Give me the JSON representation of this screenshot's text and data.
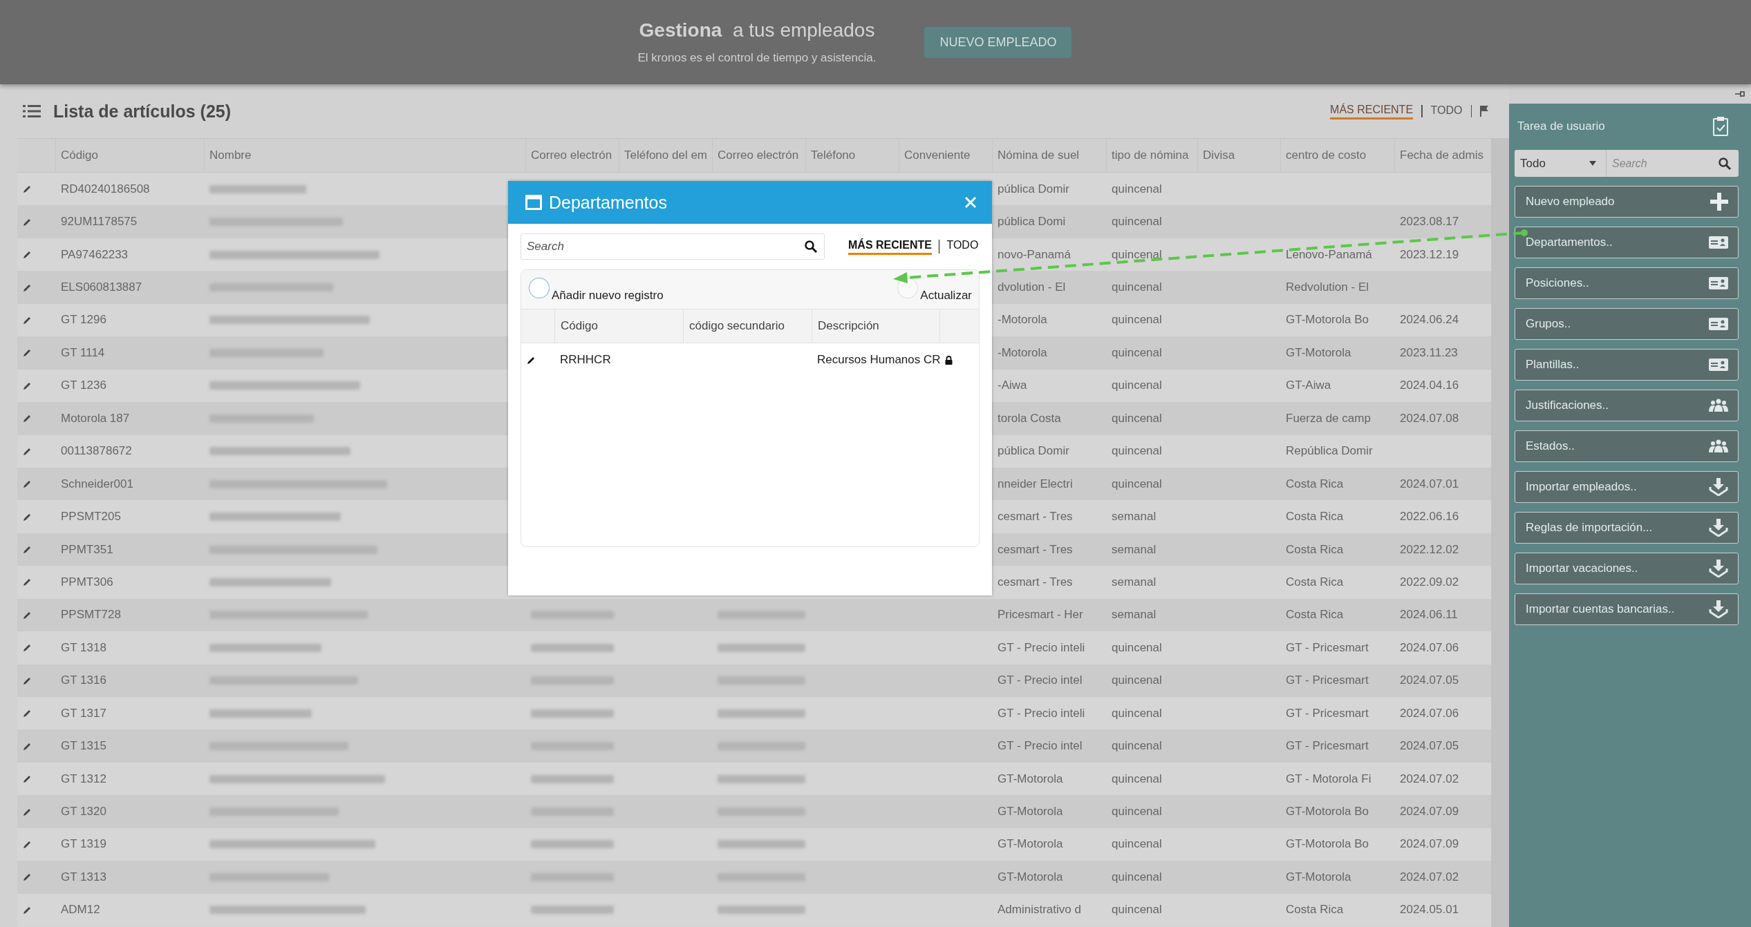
{
  "header": {
    "headline": "**Gestiona**  a tus empleados",
    "subtitle": "El kronos es el control de tiempo y asistencia.",
    "button": "NUEVO EMPLEADO"
  },
  "list": {
    "title": "Lista de artículos (25)",
    "filters": [
      {
        "label": "MÁS RECIENTE",
        "selected": true
      },
      {
        "label": "TODO",
        "selected": false
      }
    ]
  },
  "table": {
    "columns": [
      "Código",
      "Nombre",
      "Correo electrón",
      "Teléfono del em",
      "Correo electrón",
      "Teléfono",
      "Conveniente",
      "Nómina de suel",
      "tipo de nómina",
      "Divisa",
      "centro de costo",
      "Fecha de admis"
    ],
    "rows": [
      {
        "code": "RD40240186508",
        "payroll": "pública Domir",
        "payroll_type": "quincenal"
      },
      {
        "code": "92UM1178575",
        "payroll": "pública Domi",
        "payroll_type": "quincenal",
        "hire_date": "2023.08.17"
      },
      {
        "code": "PA97462233",
        "payroll": "novo-Panamá",
        "payroll_type": "quincenal",
        "cost_center": "Lenovo-Panamá",
        "hire_date": "2023.12.19"
      },
      {
        "code": "ELS060813887",
        "payroll": "dvolution - El",
        "payroll_type": "quincenal",
        "cost_center": "Redvolution - El"
      },
      {
        "code": "GT 1296",
        "payroll": "-Motorola",
        "payroll_type": "quincenal",
        "cost_center": "GT-Motorola Bo",
        "hire_date": "2024.06.24"
      },
      {
        "code": "GT 1114",
        "payroll": "-Motorola",
        "payroll_type": "quincenal",
        "cost_center": "GT-Motorola",
        "hire_date": "2023.11.23"
      },
      {
        "code": "GT 1236",
        "payroll": "-Aiwa",
        "payroll_type": "quincenal",
        "cost_center": "GT-Aiwa",
        "hire_date": "2024.04.16"
      },
      {
        "code": "Motorola 187",
        "payroll": "torola Costa",
        "payroll_type": "quincenal",
        "cost_center": "Fuerza de camp",
        "hire_date": "2024.07.08"
      },
      {
        "code": "00113878672",
        "payroll": "pública Domir",
        "payroll_type": "quincenal",
        "cost_center": "República Domir"
      },
      {
        "code": "Schneider001",
        "payroll": "nneider Electri",
        "payroll_type": "quincenal",
        "cost_center": "Costa Rica",
        "hire_date": "2024.07.01"
      },
      {
        "code": "PPSMT205",
        "payroll": "cesmart - Tres",
        "payroll_type": "semanal",
        "cost_center": "Costa Rica",
        "hire_date": "2022.06.16"
      },
      {
        "code": "PPMT351",
        "payroll": "cesmart - Tres",
        "payroll_type": "semanal",
        "cost_center": "Costa Rica",
        "hire_date": "2022.12.02"
      },
      {
        "code": "PPMT306",
        "payroll": "cesmart - Tres",
        "payroll_type": "semanal",
        "cost_center": "Costa Rica",
        "hire_date": "2022.09.02"
      },
      {
        "code": "PPSMT728",
        "payroll": "Pricesmart - Her",
        "payroll_type": "semanal",
        "cost_center": "Costa Rica",
        "hire_date": "2024.06.11"
      },
      {
        "code": "GT 1318",
        "payroll": "GT - Precio inteli",
        "payroll_type": "quincenal",
        "cost_center": "GT - Pricesmart",
        "hire_date": "2024.07.06"
      },
      {
        "code": "GT 1316",
        "payroll": "GT - Precio intel",
        "payroll_type": "quincenal",
        "cost_center": "GT - Pricesmart",
        "hire_date": "2024.07.05"
      },
      {
        "code": "GT 1317",
        "payroll": "GT - Precio inteli",
        "payroll_type": "quincenal",
        "cost_center": "GT - Pricesmart",
        "hire_date": "2024.07.06"
      },
      {
        "code": "GT 1315",
        "payroll": "GT - Precio intel",
        "payroll_type": "quincenal",
        "cost_center": "GT - Pricesmart",
        "hire_date": "2024.07.05"
      },
      {
        "code": "GT 1312",
        "payroll": "GT-Motorola",
        "payroll_type": "quincenal",
        "cost_center": "GT - Motorola Fi",
        "hire_date": "2024.07.02"
      },
      {
        "code": "GT 1320",
        "payroll": "GT-Motorola",
        "payroll_type": "quincenal",
        "cost_center": "GT-Motorola Bo",
        "hire_date": "2024.07.09"
      },
      {
        "code": "GT 1319",
        "payroll": "GT-Motorola",
        "payroll_type": "quincenal",
        "cost_center": "GT-Motorola Bo",
        "hire_date": "2024.07.09"
      },
      {
        "code": "GT 1313",
        "payroll": "GT-Motorola",
        "payroll_type": "quincenal",
        "cost_center": "GT-Motorola",
        "hire_date": "2024.07.02"
      },
      {
        "code": "ADM12",
        "payroll": "Administrativo d",
        "payroll_type": "quincenal",
        "cost_center": "Costa Rica",
        "hire_date": "2024.05.01"
      }
    ]
  },
  "dialog": {
    "title": "Departamentos",
    "search": {
      "placeholder": "Search"
    },
    "filters": [
      {
        "label": "MÁS RECIENTE",
        "selected": true
      },
      {
        "label": "TODO",
        "selected": false
      }
    ],
    "toolbar": [
      {
        "kind": "add",
        "label": "Añadir nuevo registro"
      },
      {
        "kind": "refresh",
        "label": "Actualizar"
      }
    ],
    "columns": [
      "Código",
      "código secundario",
      "Descripción"
    ],
    "rows": [
      {
        "code": "RRHHCR",
        "description": "Recursos Humanos CR",
        "locked": true
      }
    ]
  },
  "panel": {
    "title": "Tarea de usuario",
    "filter": {
      "value": "Todo",
      "placeholder": "Search"
    },
    "actions": [
      {
        "label": "Nuevo empleado",
        "kind": "plus"
      },
      {
        "label": "Departamentos..",
        "kind": "card"
      },
      {
        "label": "Posiciones..",
        "kind": "card"
      },
      {
        "label": "Grupos..",
        "kind": "card"
      },
      {
        "label": "Plantillas..",
        "kind": "card"
      },
      {
        "label": "Justificaciones..",
        "kind": "people"
      },
      {
        "label": "Estados..",
        "kind": "people"
      },
      {
        "label": "Importar empleados..",
        "kind": "download"
      },
      {
        "label": "Reglas de importación...",
        "kind": "download"
      },
      {
        "label": "Importar vacaciones..",
        "kind": "download"
      },
      {
        "label": "Importar cuentas bancarias..",
        "kind": "download"
      }
    ]
  }
}
